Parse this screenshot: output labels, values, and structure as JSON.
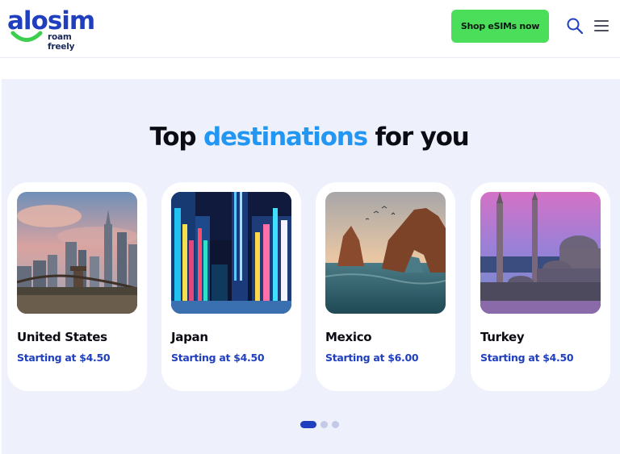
{
  "header": {
    "logo_word": "alosim",
    "logo_tagline": "roam freely",
    "shop_button": "Shop eSIMs now",
    "search_icon": "search-icon",
    "menu_icon": "hamburger-menu-icon"
  },
  "section": {
    "title_part1": "Top ",
    "title_accent": "destinations",
    "title_part2": " for you",
    "cards": [
      {
        "name": "United States",
        "price": "Starting at $4.50"
      },
      {
        "name": "Japan",
        "price": "Starting at $4.50"
      },
      {
        "name": "Mexico",
        "price": "Starting at $6.00"
      },
      {
        "name": "Turkey",
        "price": "Starting at $4.50"
      }
    ],
    "carousel": {
      "total_pages": 3,
      "active_page": 1
    }
  },
  "colors": {
    "brand_blue": "#1f3fbf",
    "accent_blue": "#2196f3",
    "shop_green": "#4ade5b",
    "section_bg": "#eef1fb"
  }
}
